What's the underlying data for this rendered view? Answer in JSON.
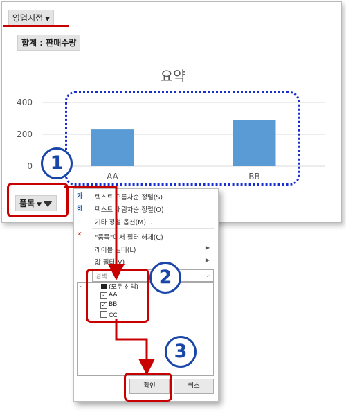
{
  "pivot": {
    "filter_field_label": "영업지점",
    "value_field_label": "합계 : 판매수량",
    "axis_field_label": "품목"
  },
  "chart_data": {
    "type": "bar",
    "title": "요약",
    "categories": [
      "AA",
      "BB"
    ],
    "values": [
      230,
      290
    ],
    "ylim": [
      0,
      400
    ],
    "yticks": [
      "0",
      "200",
      "400"
    ],
    "grid": true,
    "bar_color": "#5b9bd5"
  },
  "filter_menu": {
    "items": [
      {
        "icon": "sort-ascending-icon",
        "glyph": "가",
        "label": "텍스트 오름차순 정렬(S)"
      },
      {
        "icon": "sort-descending-icon",
        "glyph": "하",
        "label": "텍스트 내림차순 정렬(O)"
      },
      {
        "icon": "",
        "glyph": "",
        "label": "기타 정렬 옵션(M)..."
      },
      {
        "icon": "clear-filter-icon",
        "glyph": "✕",
        "label": "\"품목\"에서 필터 해제(C)"
      },
      {
        "icon": "",
        "glyph": "",
        "label": "레이블 필터(L)",
        "submenu": true
      },
      {
        "icon": "",
        "glyph": "",
        "label": "값 필터(V)",
        "submenu": true
      }
    ],
    "search_placeholder": "검색",
    "checklist": [
      {
        "label": "(모두 선택)",
        "state": "partial"
      },
      {
        "label": "AA",
        "state": "checked"
      },
      {
        "label": "BB",
        "state": "checked"
      },
      {
        "label": "CC",
        "state": "unchecked"
      }
    ],
    "ok_label": "확인",
    "cancel_label": "취소"
  },
  "callouts": {
    "step1": "1",
    "step2": "2",
    "step3": "3"
  },
  "colors": {
    "accent_red": "#c80000",
    "callout_blue": "#1946a8",
    "dotted_blue": "#1a2fd0"
  }
}
